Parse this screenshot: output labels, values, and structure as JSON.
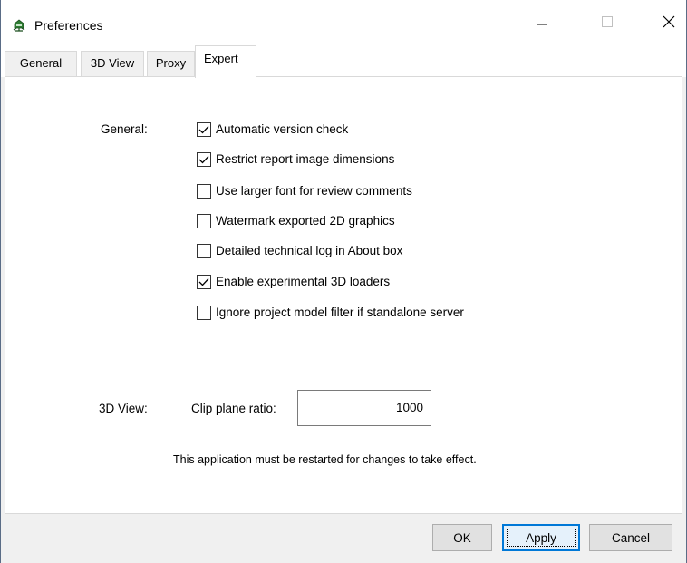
{
  "window": {
    "title": "Preferences",
    "minimize_glyph": "—",
    "maximize_glyph": "☐",
    "close_glyph": "✕"
  },
  "tabs": [
    {
      "label": "General",
      "active": false
    },
    {
      "label": "3D View",
      "active": false
    },
    {
      "label": "Proxy",
      "active": false
    },
    {
      "label": "Expert",
      "active": true
    }
  ],
  "general_section": {
    "label": "General:",
    "options": [
      {
        "label": "Automatic version check",
        "checked": true
      },
      {
        "label": "Restrict report image dimensions",
        "checked": true
      },
      {
        "label": "Use larger font for review comments",
        "checked": false
      },
      {
        "label": "Watermark exported 2D graphics",
        "checked": false
      },
      {
        "label": "Detailed technical log in About box",
        "checked": false
      },
      {
        "label": "Enable experimental 3D loaders",
        "checked": true
      },
      {
        "label": "Ignore project model filter if standalone server",
        "checked": false
      }
    ]
  },
  "view3d_section": {
    "label": "3D View:",
    "clip_plane_label": "Clip plane ratio:",
    "clip_plane_value": "1000"
  },
  "restart_note": "This application must be restarted for changes to take effect.",
  "buttons": {
    "ok": "OK",
    "apply": "Apply",
    "cancel": "Cancel"
  },
  "colors": {
    "accent": "#0078d7",
    "icon_green": "#2e7d32"
  }
}
